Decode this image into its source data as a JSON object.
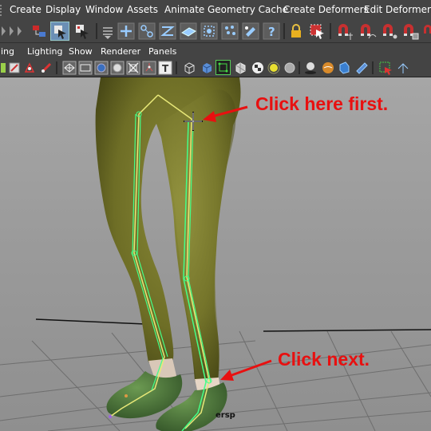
{
  "menubar": {
    "items": [
      "Create",
      "Display",
      "Window",
      "Assets",
      "Animate",
      "Geometry Cache",
      "Create Deformers",
      "Edit Deformers"
    ]
  },
  "panel_menu": {
    "items": [
      "ding",
      "Lighting",
      "Show",
      "Renderer",
      "Panels"
    ]
  },
  "viewport": {
    "camera_label": "ersp"
  },
  "annotations": {
    "first": "Click here first.",
    "next": "Click next."
  },
  "colors": {
    "annotation": "#e81010",
    "joint_highlight": "#44ff88",
    "mesh": "#7a7a2c",
    "shoe": "#4f7a3a"
  }
}
